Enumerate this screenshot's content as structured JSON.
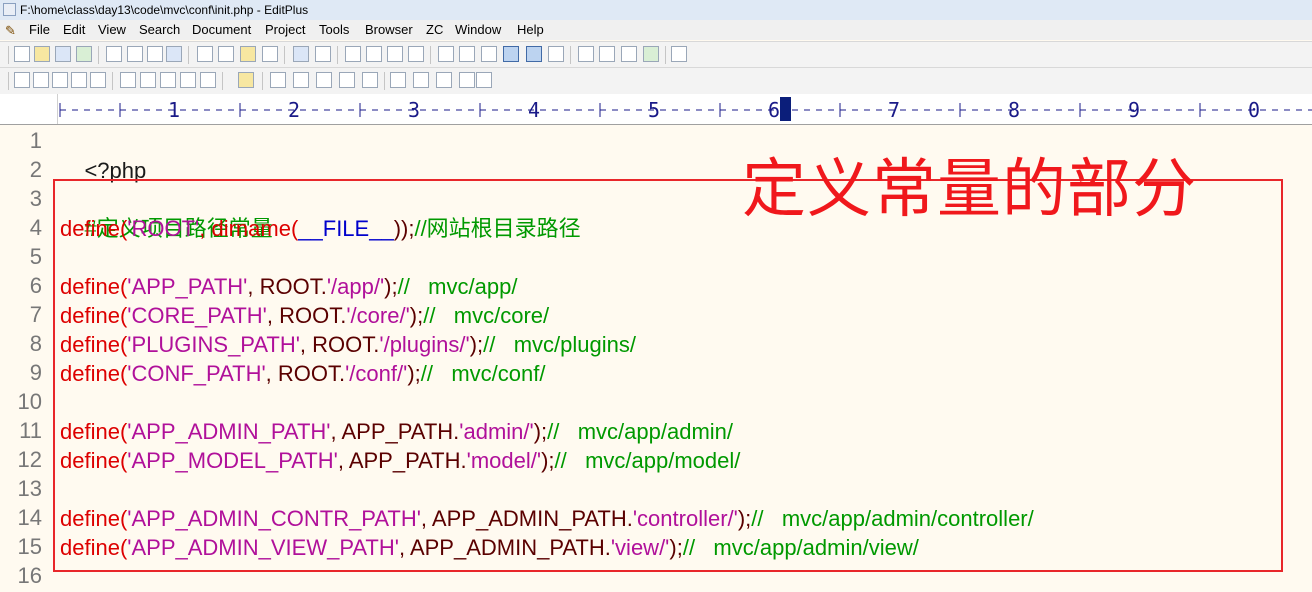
{
  "window": {
    "title": "F:\\home\\class\\day13\\code\\mvc\\conf\\init.php - EditPlus"
  },
  "menu": [
    {
      "label": "File"
    },
    {
      "label": "Edit"
    },
    {
      "label": "View"
    },
    {
      "label": "Search"
    },
    {
      "label": "Document"
    },
    {
      "label": "Project"
    },
    {
      "label": "Tools"
    },
    {
      "label": "Browser"
    },
    {
      "label": "ZC"
    },
    {
      "label": "Window"
    },
    {
      "label": "Help"
    }
  ],
  "ruler": {
    "numbers": [
      "1",
      "2",
      "3",
      "4",
      "5",
      "6",
      "7",
      "8",
      "9",
      "0"
    ],
    "cursor_column": "6"
  },
  "line_numbers": [
    "1",
    "2",
    "3",
    "4",
    "5",
    "6",
    "7",
    "8",
    "9",
    "10",
    "11",
    "12",
    "13",
    "14",
    "15",
    "16"
  ],
  "code": {
    "l1": {
      "php": "<?php"
    },
    "l3": {
      "cmt": "#定义项目路径常量"
    },
    "l4": {
      "def": "define(",
      "str": "'ROOT'",
      "mid": ", dirname(",
      "const": "__FILE__",
      "end": "));",
      "cmt": "//网站根目录路径"
    },
    "l6": {
      "def": "define(",
      "str": "'APP_PATH'",
      "mid": ", ROOT.",
      "str2": "'/app/'",
      "end": ");",
      "cmt": "//   mvc/app/"
    },
    "l7": {
      "def": "define(",
      "str": "'CORE_PATH'",
      "mid": ", ROOT.",
      "str2": "'/core/'",
      "end": ");",
      "cmt": "//   mvc/core/"
    },
    "l8": {
      "def": "define(",
      "str": "'PLUGINS_PATH'",
      "mid": ", ROOT.",
      "str2": "'/plugins/'",
      "end": ");",
      "cmt": "//   mvc/plugins/"
    },
    "l9": {
      "def": "define(",
      "str": "'CONF_PATH'",
      "mid": ", ROOT.",
      "str2": "'/conf/'",
      "end": ");",
      "cmt": "//   mvc/conf/"
    },
    "l11": {
      "def": "define(",
      "str": "'APP_ADMIN_PATH'",
      "mid": ", APP_PATH.",
      "str2": "'admin/'",
      "end": ");",
      "cmt": "//   mvc/app/admin/"
    },
    "l12": {
      "def": "define(",
      "str": "'APP_MODEL_PATH'",
      "mid": ", APP_PATH.",
      "str2": "'model/'",
      "end": ");",
      "cmt": "//   mvc/app/model/"
    },
    "l14": {
      "def": "define(",
      "str": "'APP_ADMIN_CONTR_PATH'",
      "mid": ", APP_ADMIN_PATH.",
      "str2": "'controller/'",
      "end": ");",
      "cmt": "//   mvc/app/admin/controller/"
    },
    "l15": {
      "def": "define(",
      "str": "'APP_ADMIN_VIEW_PATH'",
      "mid": ", APP_ADMIN_PATH.",
      "str2": "'view/'",
      "end": ");",
      "cmt": "//   mvc/app/admin/view/"
    }
  },
  "annotation": {
    "text": "定义常量的部分",
    "color": "#f0181c"
  },
  "colors": {
    "keyword": "#dd0000",
    "string": "#b0109a",
    "comment": "#009900",
    "constant": "#0000cc",
    "highlight": "#e8262a"
  }
}
